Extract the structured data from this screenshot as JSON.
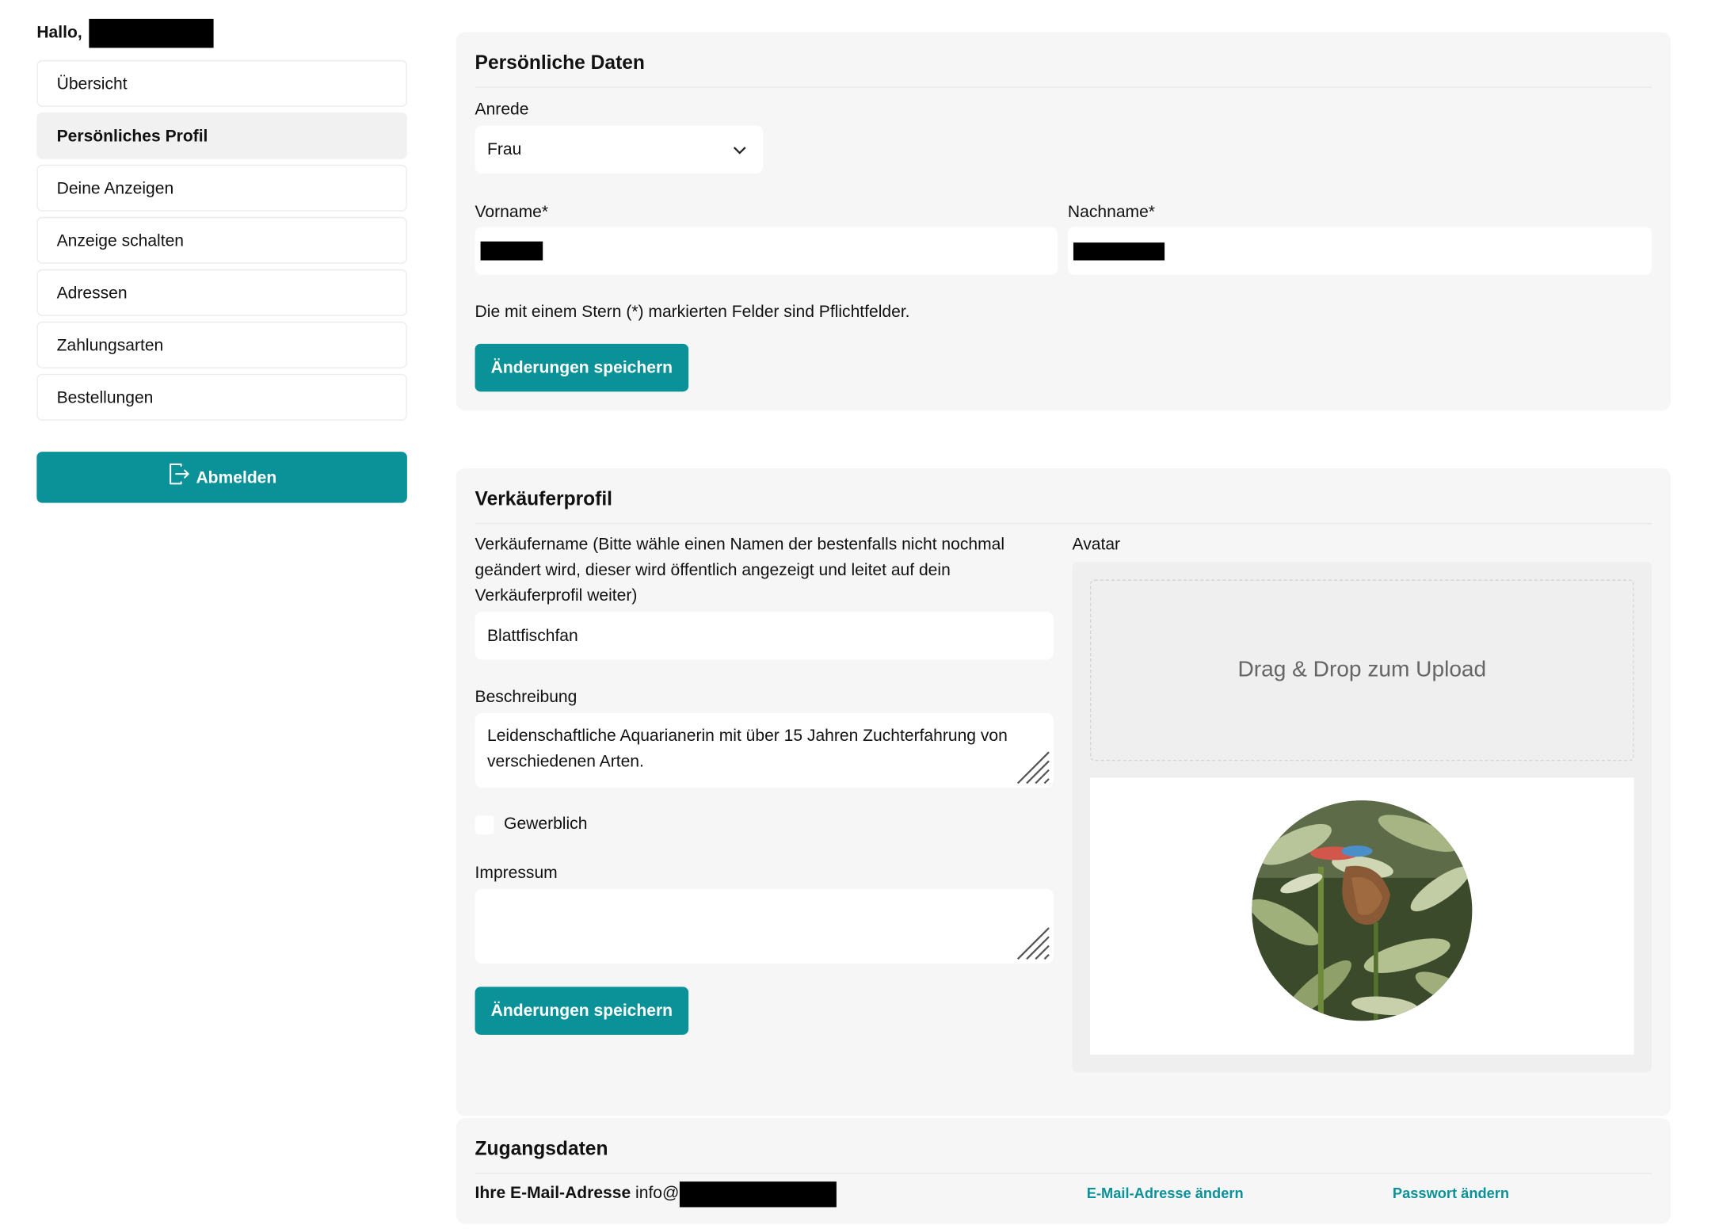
{
  "sidebar": {
    "greeting": "Hallo,",
    "items": [
      {
        "label": "Übersicht",
        "active": false
      },
      {
        "label": "Persönliches Profil",
        "active": true
      },
      {
        "label": "Deine Anzeigen",
        "active": false
      },
      {
        "label": "Anzeige schalten",
        "active": false
      },
      {
        "label": "Adressen",
        "active": false
      },
      {
        "label": "Zahlungsarten",
        "active": false
      },
      {
        "label": "Bestellungen",
        "active": false
      }
    ],
    "logout_label": "Abmelden"
  },
  "personal": {
    "title": "Persönliche Daten",
    "salutation_label": "Anrede",
    "salutation_value": "Frau",
    "firstname_label": "Vorname*",
    "lastname_label": "Nachname*",
    "required_note": "Die mit einem Stern (*) markierten Felder sind Pflichtfelder.",
    "save_label": "Änderungen speichern"
  },
  "seller": {
    "title": "Verkäuferprofil",
    "name_label": "Verkäufername (Bitte wähle einen Namen der bestenfalls nicht nochmal geändert wird, dieser wird öffentlich angezeigt und leitet auf dein Verkäuferprofil weiter)",
    "name_value": "Blattfischfan",
    "description_label": "Beschreibung",
    "description_value": "Leidenschaftliche Aquarianerin mit über 15 Jahren Zuchterfahrung von verschiedenen Arten.",
    "commercial_label": "Gewerblich",
    "imprint_label": "Impressum",
    "imprint_value": "",
    "save_label": "Änderungen speichern",
    "avatar_label": "Avatar",
    "dropzone_text": "Drag & Drop zum Upload"
  },
  "access": {
    "title": "Zugangsdaten",
    "email_label": "Ihre E-Mail-Adresse",
    "email_value_visible": "info@",
    "change_email_label": "E-Mail-Adresse ändern",
    "change_password_label": "Passwort ändern"
  },
  "colors": {
    "accent": "#0b9198",
    "card_bg": "#f6f6f6"
  }
}
